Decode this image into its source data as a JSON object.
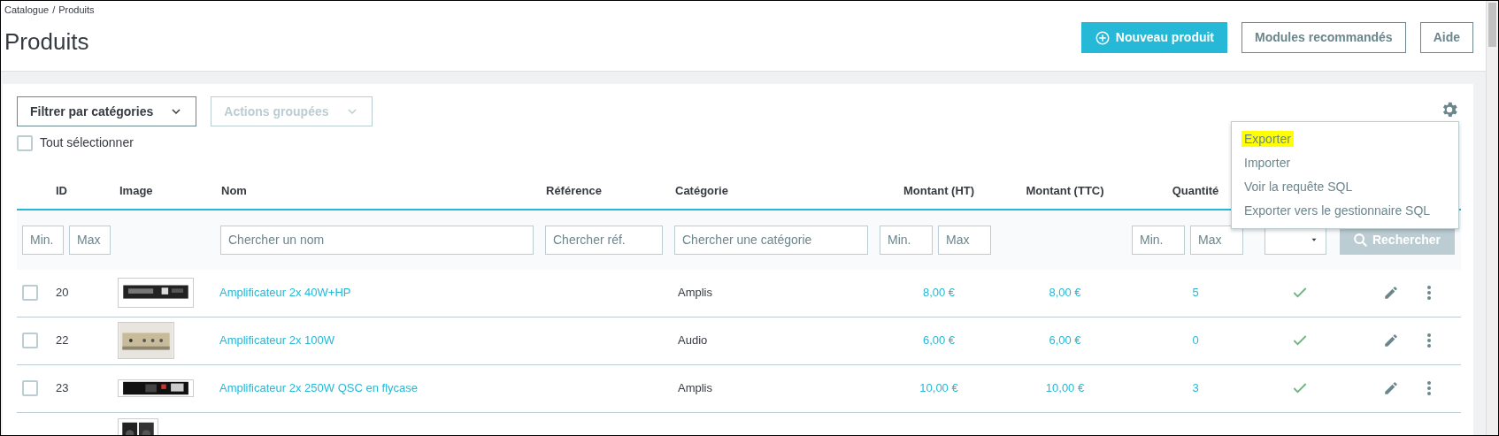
{
  "breadcrumb": {
    "items": [
      "Catalogue",
      "Produits"
    ],
    "separator": "/"
  },
  "page_title": "Produits",
  "header_buttons": [
    {
      "label": "Nouveau produit",
      "kind": "primary"
    },
    {
      "label": "Modules recommandés",
      "kind": "outline"
    },
    {
      "label": "Aide",
      "kind": "outline"
    }
  ],
  "toolbar": {
    "dropdowns": [
      {
        "label": "Filtrer par catégories",
        "disabled": false
      },
      {
        "label": "Actions groupées",
        "disabled": true
      }
    ],
    "select_all": {
      "label": "Tout sélectionner",
      "checked": false
    }
  },
  "settings_menu": {
    "open": true,
    "items": [
      {
        "label": "Exporter",
        "highlighted": true
      },
      {
        "label": "Importer",
        "highlighted": false
      },
      {
        "label": "Voir la requête SQL",
        "highlighted": false
      },
      {
        "label": "Exporter vers le gestionnaire SQL",
        "highlighted": false
      }
    ]
  },
  "table": {
    "columns": [
      "",
      "ID",
      "Image",
      "Nom",
      "Référence",
      "Catégorie",
      "Montant (HT)",
      "Montant (TTC)",
      "Quantité",
      "",
      ""
    ],
    "filters": [
      {
        "kind": "range",
        "min_placeholder": "Min.",
        "max_placeholder": "Max"
      },
      {
        "kind": "none"
      },
      {
        "kind": "text",
        "placeholder": "Chercher un nom"
      },
      {
        "kind": "text",
        "placeholder": "Chercher réf."
      },
      {
        "kind": "text",
        "placeholder": "Chercher une catégorie"
      },
      {
        "kind": "range",
        "min_placeholder": "Min.",
        "max_placeholder": "Max"
      },
      {
        "kind": "none"
      },
      {
        "kind": "range",
        "min_placeholder": "Min.",
        "max_placeholder": "Max"
      },
      {
        "kind": "select"
      },
      {
        "kind": "button",
        "label": "Rechercher",
        "disabled": true
      }
    ],
    "rows": [
      {
        "checked": false,
        "id": "20",
        "name": "Amplificateur  2x 40W+HP",
        "category": "Amplis",
        "price_ht": "8,00 €",
        "price_ttc": "8,00 €",
        "quantity": "5",
        "active": true
      },
      {
        "checked": false,
        "id": "22",
        "name": "Amplificateur 2x 100W",
        "category": "Audio",
        "price_ht": "6,00 €",
        "price_ttc": "6,00 €",
        "quantity": "0",
        "active": true
      },
      {
        "checked": false,
        "id": "23",
        "name": "Amplificateur 2x 250W QSC en flycase",
        "category": "Amplis",
        "price_ht": "10,00 €",
        "price_ttc": "10,00 €",
        "quantity": "3",
        "active": true
      },
      {
        "kind": "partial"
      }
    ]
  }
}
